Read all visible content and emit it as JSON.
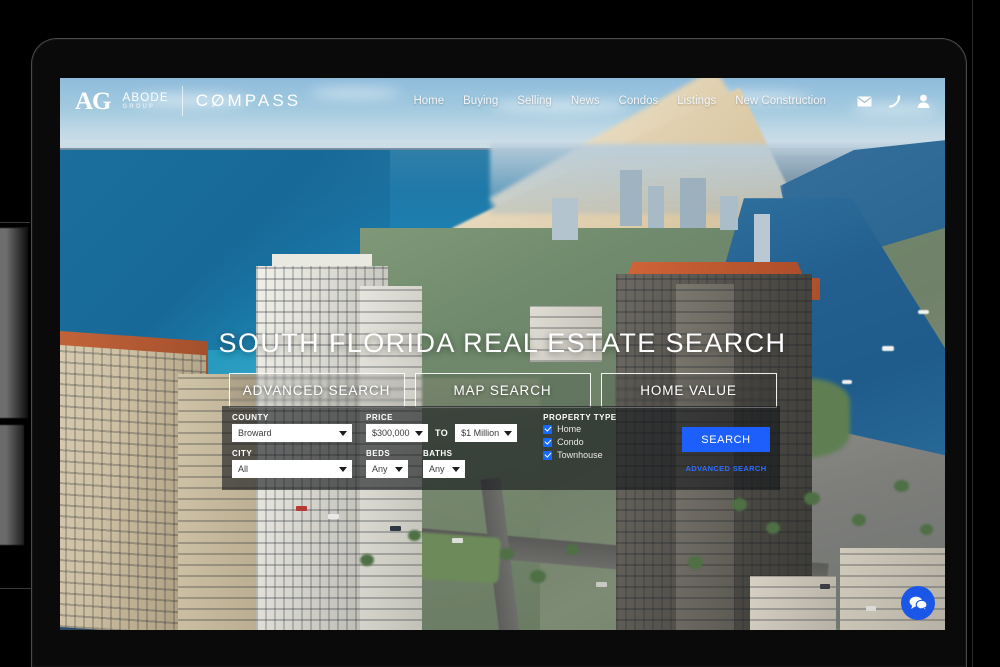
{
  "device": {
    "type": "tablet",
    "camera": "front-camera"
  },
  "site": {
    "logo": {
      "mark": "AG",
      "brand_line1": "ABODE",
      "brand_line2": "GROUP",
      "partner": "COMPASS"
    },
    "nav": {
      "items": [
        {
          "label": "Home"
        },
        {
          "label": "Buying"
        },
        {
          "label": "Selling"
        },
        {
          "label": "News"
        },
        {
          "label": "Condos"
        },
        {
          "label": "Listings"
        },
        {
          "label": "New Construction"
        }
      ],
      "icons": [
        {
          "name": "envelope-icon"
        },
        {
          "name": "phone-icon"
        },
        {
          "name": "user-icon"
        }
      ]
    },
    "hero": {
      "title": "SOUTH FLORIDA REAL ESTATE SEARCH",
      "buttons": [
        {
          "label": "ADVANCED SEARCH"
        },
        {
          "label": "MAP SEARCH"
        },
        {
          "label": "HOME VALUE"
        }
      ]
    },
    "search_form": {
      "county": {
        "label": "COUNTY",
        "value": "Broward"
      },
      "city": {
        "label": "CITY",
        "value": "All"
      },
      "price": {
        "label": "PRICE",
        "min": "$300,000",
        "to": "TO",
        "max": "$1 Million"
      },
      "beds": {
        "label": "BEDS",
        "value": "Any"
      },
      "baths": {
        "label": "BATHS",
        "value": "Any"
      },
      "property_type": {
        "label": "PROPERTY TYPE",
        "options": [
          {
            "label": "Home",
            "checked": true
          },
          {
            "label": "Condo",
            "checked": true
          },
          {
            "label": "Townhouse",
            "checked": true
          }
        ]
      },
      "submit_label": "SEARCH",
      "advanced_link": "ADVANCED SEARCH"
    },
    "chat_widget": {
      "name": "chat-bubble-icon"
    },
    "colors": {
      "accent_blue": "#1d5ffb",
      "link_blue": "#2f6dff",
      "checkbox_blue": "#1569ff",
      "chat_blue": "#1a56e8",
      "panel_overlay": "rgba(20,22,26,0.62)",
      "text_white": "#ffffff",
      "device_frame": "#0a0a0a",
      "page_background": "#000000"
    },
    "hero_image": {
      "description": "Aerial photograph of a South Florida coastline with ocean, beach, high-rise condo towers, an intracoastal waterway and marina"
    }
  }
}
